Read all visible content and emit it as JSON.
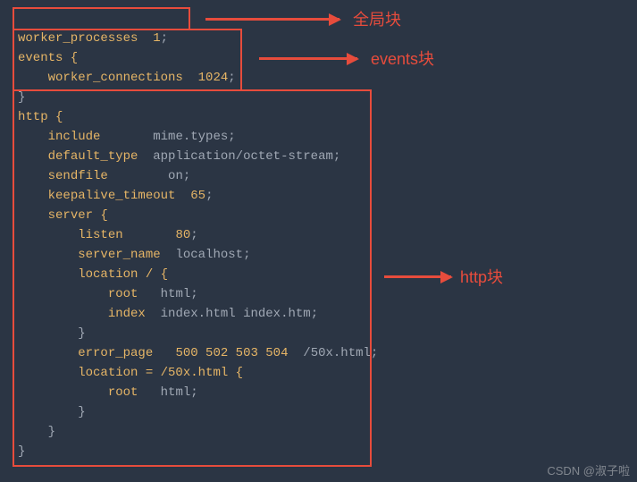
{
  "labels": {
    "global": "全局块",
    "events": "events块",
    "http": "http块"
  },
  "watermark": "CSDN @淑子啦",
  "config": {
    "worker_processes": {
      "directive": "worker_processes",
      "value": "1"
    },
    "events": {
      "open": "events {",
      "worker_connections": {
        "directive": "worker_connections",
        "value": "1024"
      },
      "close": "}"
    },
    "http": {
      "open": "http {",
      "include": {
        "directive": "include",
        "value": "mime.types"
      },
      "default_type": {
        "directive": "default_type",
        "value": "application/octet-stream"
      },
      "sendfile": {
        "directive": "sendfile",
        "value": "on"
      },
      "keepalive_timeout": {
        "directive": "keepalive_timeout",
        "value": "65"
      },
      "server": {
        "open": "server {",
        "listen": {
          "directive": "listen",
          "value": "80"
        },
        "server_name": {
          "directive": "server_name",
          "value": "localhost"
        },
        "location_root": {
          "open": "location / {",
          "root": {
            "directive": "root",
            "value": "html"
          },
          "index": {
            "directive": "index",
            "value": "index.html index.htm"
          },
          "close": "}"
        },
        "error_page": {
          "directive": "error_page",
          "codes": "500 502 503 504",
          "value": "/50x.html"
        },
        "location_50x": {
          "open": "location = /50x.html {",
          "root": {
            "directive": "root",
            "value": "html"
          },
          "close": "}"
        },
        "close": "}"
      },
      "close": "}"
    }
  }
}
